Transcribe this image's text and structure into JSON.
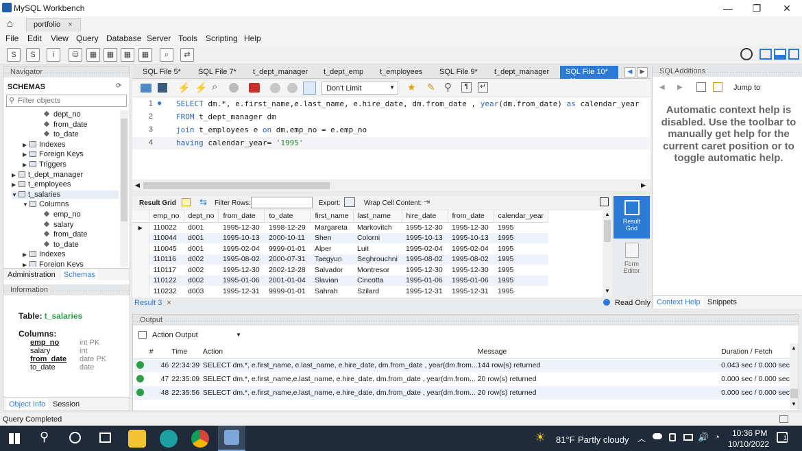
{
  "window": {
    "title": "MySQL Workbench",
    "minimize": "—",
    "restore": "❐",
    "close": "✕"
  },
  "connection_tab": {
    "label": "portfolio",
    "close": "×"
  },
  "menu": [
    "File",
    "Edit",
    "View",
    "Query",
    "Database",
    "Server",
    "Tools",
    "Scripting",
    "Help"
  ],
  "navigator": {
    "title": "Navigator",
    "schemas_label": "SCHEMAS",
    "filter_placeholder": "Filter objects",
    "tree": [
      {
        "type": "dia",
        "indent": 90,
        "label": "dept_no"
      },
      {
        "type": "dia",
        "indent": 90,
        "label": "from_date"
      },
      {
        "type": "dia",
        "indent": 90,
        "label": "to_date"
      },
      {
        "type": "folder",
        "indent": 58,
        "label": "Indexes",
        "arrow": "▶"
      },
      {
        "type": "folder",
        "indent": 58,
        "label": "Foreign Keys",
        "arrow": "▶"
      },
      {
        "type": "folder",
        "indent": 58,
        "label": "Triggers",
        "arrow": "▶"
      },
      {
        "type": "table",
        "indent": 42,
        "label": "t_dept_manager",
        "arrow": "▶"
      },
      {
        "type": "table",
        "indent": 42,
        "label": "t_employees",
        "arrow": "▶"
      },
      {
        "type": "table",
        "indent": 42,
        "label": "t_salaries",
        "arrow": "▼"
      },
      {
        "type": "folder",
        "indent": 58,
        "label": "Columns",
        "arrow": "▼"
      },
      {
        "type": "dia",
        "indent": 90,
        "label": "emp_no"
      },
      {
        "type": "dia",
        "indent": 90,
        "label": "salary"
      },
      {
        "type": "dia",
        "indent": 90,
        "label": "from_date"
      },
      {
        "type": "dia",
        "indent": 90,
        "label": "to_date"
      },
      {
        "type": "folder",
        "indent": 58,
        "label": "Indexes",
        "arrow": "▶"
      },
      {
        "type": "folder",
        "indent": 58,
        "label": "Foreign Keys",
        "arrow": "▶"
      }
    ],
    "tab_admin": "Administration",
    "tab_schemas": "Schemas"
  },
  "information": {
    "title": "Information",
    "table_label": "Table:",
    "table_name": "t_salaries",
    "columns_label": "Columns:",
    "columns": [
      {
        "name": "emp_no",
        "type": "int PK",
        "bold": true
      },
      {
        "name": "salary",
        "type": "int",
        "bold": false
      },
      {
        "name": "from_date",
        "type": "date PK",
        "bold": true
      },
      {
        "name": "to_date",
        "type": "date",
        "bold": false
      }
    ],
    "tab_objinfo": "Object Info",
    "tab_session": "Session"
  },
  "editor_tabs": [
    "SQL File 5*",
    "SQL File 7*",
    "t_dept_manager",
    "t_dept_emp",
    "t_employees",
    "SQL File 9*",
    "t_dept_manager"
  ],
  "active_tab": "SQL File 10*",
  "limit": "Don't Limit",
  "code": {
    "line_numbers": [
      "1",
      "2",
      "3",
      "4"
    ]
  },
  "result": {
    "grid_label": "Result Grid",
    "filter_label": "Filter Rows:",
    "export_label": "Export:",
    "wrap_label": "Wrap Cell Content:",
    "columns": [
      "emp_no",
      "dept_no",
      "from_date",
      "to_date",
      "first_name",
      "last_name",
      "hire_date",
      "from_date",
      "calendar_year"
    ],
    "rows": [
      [
        "110022",
        "d001",
        "1995-12-30",
        "1998-12-29",
        "Margareta",
        "Markovitch",
        "1995-12-30",
        "1995-12-30",
        "1995"
      ],
      [
        "110044",
        "d001",
        "1995-10-13",
        "2000-10-11",
        "Shen",
        "Colorni",
        "1995-10-13",
        "1995-10-13",
        "1995"
      ],
      [
        "110045",
        "d001",
        "1995-02-04",
        "9999-01-01",
        "Alper",
        "Luit",
        "1995-02-04",
        "1995-02-04",
        "1995"
      ],
      [
        "110116",
        "d002",
        "1995-08-02",
        "2000-07-31",
        "Taegyun",
        "Seghrouchni",
        "1995-08-02",
        "1995-08-02",
        "1995"
      ],
      [
        "110117",
        "d002",
        "1995-12-30",
        "2002-12-28",
        "Salvador",
        "Montresor",
        "1995-12-30",
        "1995-12-30",
        "1995"
      ],
      [
        "110122",
        "d002",
        "1995-01-06",
        "2001-01-04",
        "Slavian",
        "Cincotta",
        "1995-01-06",
        "1995-01-06",
        "1995"
      ],
      [
        "110232",
        "d003",
        "1995-12-31",
        "9999-01-01",
        "Sahrah",
        "Szilard",
        "1995-12-31",
        "1995-12-31",
        "1995"
      ]
    ],
    "result_tab": "Result 3",
    "result_tab_close": "×",
    "side_grid": "Result Grid",
    "side_form": "Form Editor",
    "read_only": "Read Only"
  },
  "sql_additions": {
    "title": "SQLAdditions",
    "jump_to": "Jump to",
    "help_text": "Automatic context help is disabled. Use the toolbar to manually get help for the current caret position or to toggle automatic help.",
    "tab_context": "Context Help",
    "tab_snippets": "Snippets"
  },
  "output": {
    "title": "Output",
    "selector": "Action Output",
    "headers": [
      "#",
      "Time",
      "Action",
      "Message",
      "Duration / Fetch"
    ],
    "rows": [
      {
        "n": "46",
        "time": "22:34:39",
        "action": "SELECT dm.*, e.first_name, e.last_name, e.hire_date, dm.from_date , year(dm.from...",
        "msg": "144 row(s) returned",
        "dur": "0.043 sec / 0.000 sec"
      },
      {
        "n": "47",
        "time": "22:35:09",
        "action": "SELECT dm.*, e.first_name,e.last_name, e.hire_date, dm.from_date , year(dm.from...",
        "msg": "20 row(s) returned",
        "dur": "0.000 sec / 0.000 sec"
      },
      {
        "n": "48",
        "time": "22:35:56",
        "action": "SELECT dm.*, e.first_name,e.last_name, e.hire_date, dm.from_date , year(dm.from...",
        "msg": "20 row(s) returned",
        "dur": "0.000 sec / 0.000 sec"
      }
    ]
  },
  "status": "Query Completed",
  "taskbar": {
    "weather_temp": "81°F",
    "weather_desc": "Partly cloudy",
    "time": "10:36 PM",
    "date": "10/10/2022",
    "notif_count": "1"
  },
  "colors": {
    "accent": "#2b7bd6",
    "ok": "#2e9e44",
    "keyword": "#2b63c9",
    "string": "#2c8a2c"
  }
}
